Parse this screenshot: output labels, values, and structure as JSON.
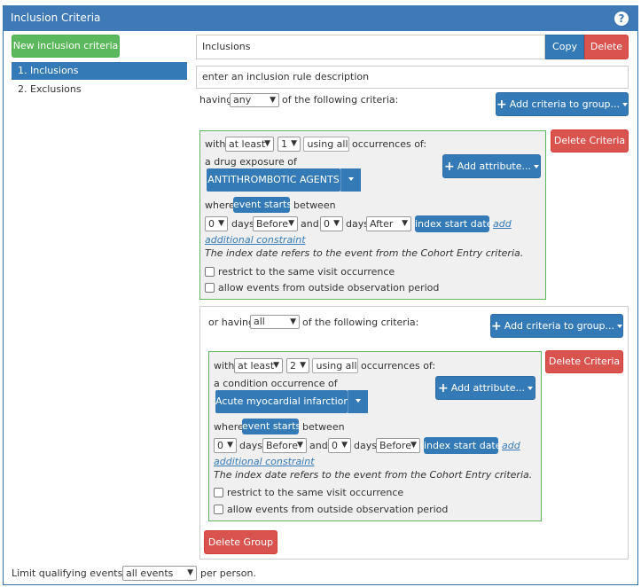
{
  "header": {
    "title": "Inclusion Criteria",
    "help_icon": "?"
  },
  "sidebar": {
    "new_button": "New inclusion criteria",
    "items": [
      {
        "label": "1. Inclusions"
      },
      {
        "label": "2. Exclusions"
      }
    ]
  },
  "rule": {
    "name": "Inclusions",
    "copy_label": "Copy",
    "delete_label": "Delete",
    "description_placeholder": "enter an inclusion rule description",
    "having_label": "having",
    "having_value": "any",
    "following_label": "of the following criteria:",
    "add_criteria_label": "Add criteria to group...",
    "delete_criteria_label": "Delete Criteria"
  },
  "criteria1": {
    "with_label": "with",
    "at_least": "at least",
    "count": "1",
    "using_all": "using all",
    "occurrences_label": "occurrences of:",
    "domain_label": "a drug exposure of",
    "concept": "ANTITHROMBOTIC AGENTS",
    "add_attribute_label": "Add attribute...",
    "where_label": "where",
    "event_starts": "event starts",
    "between_label": "between",
    "days1": "0",
    "days_label": "days",
    "before": "Before",
    "and_label": "and",
    "days2": "0",
    "after": "After",
    "index_start_date": "index start date",
    "add_label": "add",
    "additional_constraint": "additional constraint",
    "index_note": "The index date refers to the event from the Cohort Entry criteria.",
    "restrict_label": "restrict to the same visit occurrence",
    "allow_label": "allow events from outside observation period"
  },
  "group": {
    "or_having_label": "or having",
    "having_value": "all",
    "following_label": "of the following criteria:",
    "add_criteria_label": "Add criteria to group...",
    "delete_criteria_label": "Delete Criteria",
    "delete_group_label": "Delete Group"
  },
  "criteria2": {
    "with_label": "with",
    "at_least": "at least",
    "count": "2",
    "using_all": "using all",
    "occurrences_label": "occurrences of:",
    "domain_label": "a condition occurrence of",
    "concept": "Acute myocardial infarction",
    "add_attribute_label": "Add attribute...",
    "where_label": "where",
    "event_starts": "event starts",
    "between_label": "between",
    "days1": "0",
    "days_label": "days",
    "before": "Before",
    "and_label": "and",
    "days2": "0",
    "before2": "Before",
    "index_start_date": "index start date",
    "add_label": "add",
    "additional_constraint": "additional constraint",
    "index_note": "The index date refers to the event from the Cohort Entry criteria.",
    "restrict_label": "restrict to the same visit occurrence",
    "allow_label": "allow events from outside observation period"
  },
  "footer": {
    "limit_label": "Limit qualifying events to:",
    "limit_value": "all events",
    "per_person": "per person."
  },
  "colors": {
    "header": "#3f7ab6",
    "primary": "#337ab7",
    "danger": "#d9534f",
    "success": "#5cb85c"
  }
}
